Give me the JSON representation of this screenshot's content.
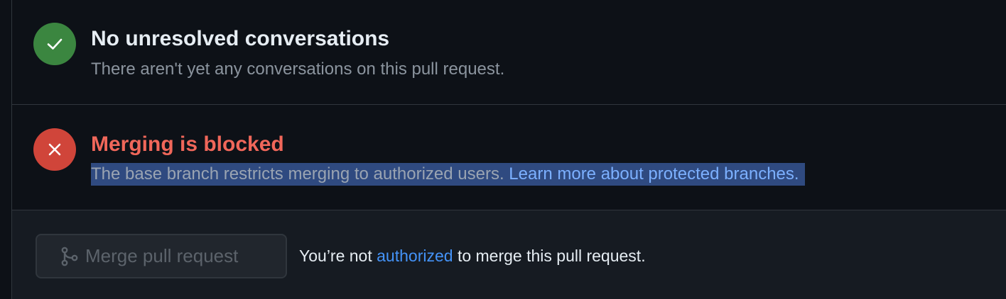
{
  "conversations": {
    "status_icon": "check-icon",
    "status_color": "#3b8640",
    "title": "No unresolved conversations",
    "description": "There aren't yet any conversations on this pull request."
  },
  "merge_block": {
    "status_icon": "x-icon",
    "status_color": "#d0453a",
    "title": "Merging is blocked",
    "description": "The base branch restricts merging to authorized users.",
    "link_text": "Learn more about protected branches."
  },
  "merge_action": {
    "button_icon": "git-merge-icon",
    "button_label": "Merge pull request",
    "note_prefix": "You’re not",
    "note_link": "authorized",
    "note_suffix": "to merge this pull request."
  }
}
